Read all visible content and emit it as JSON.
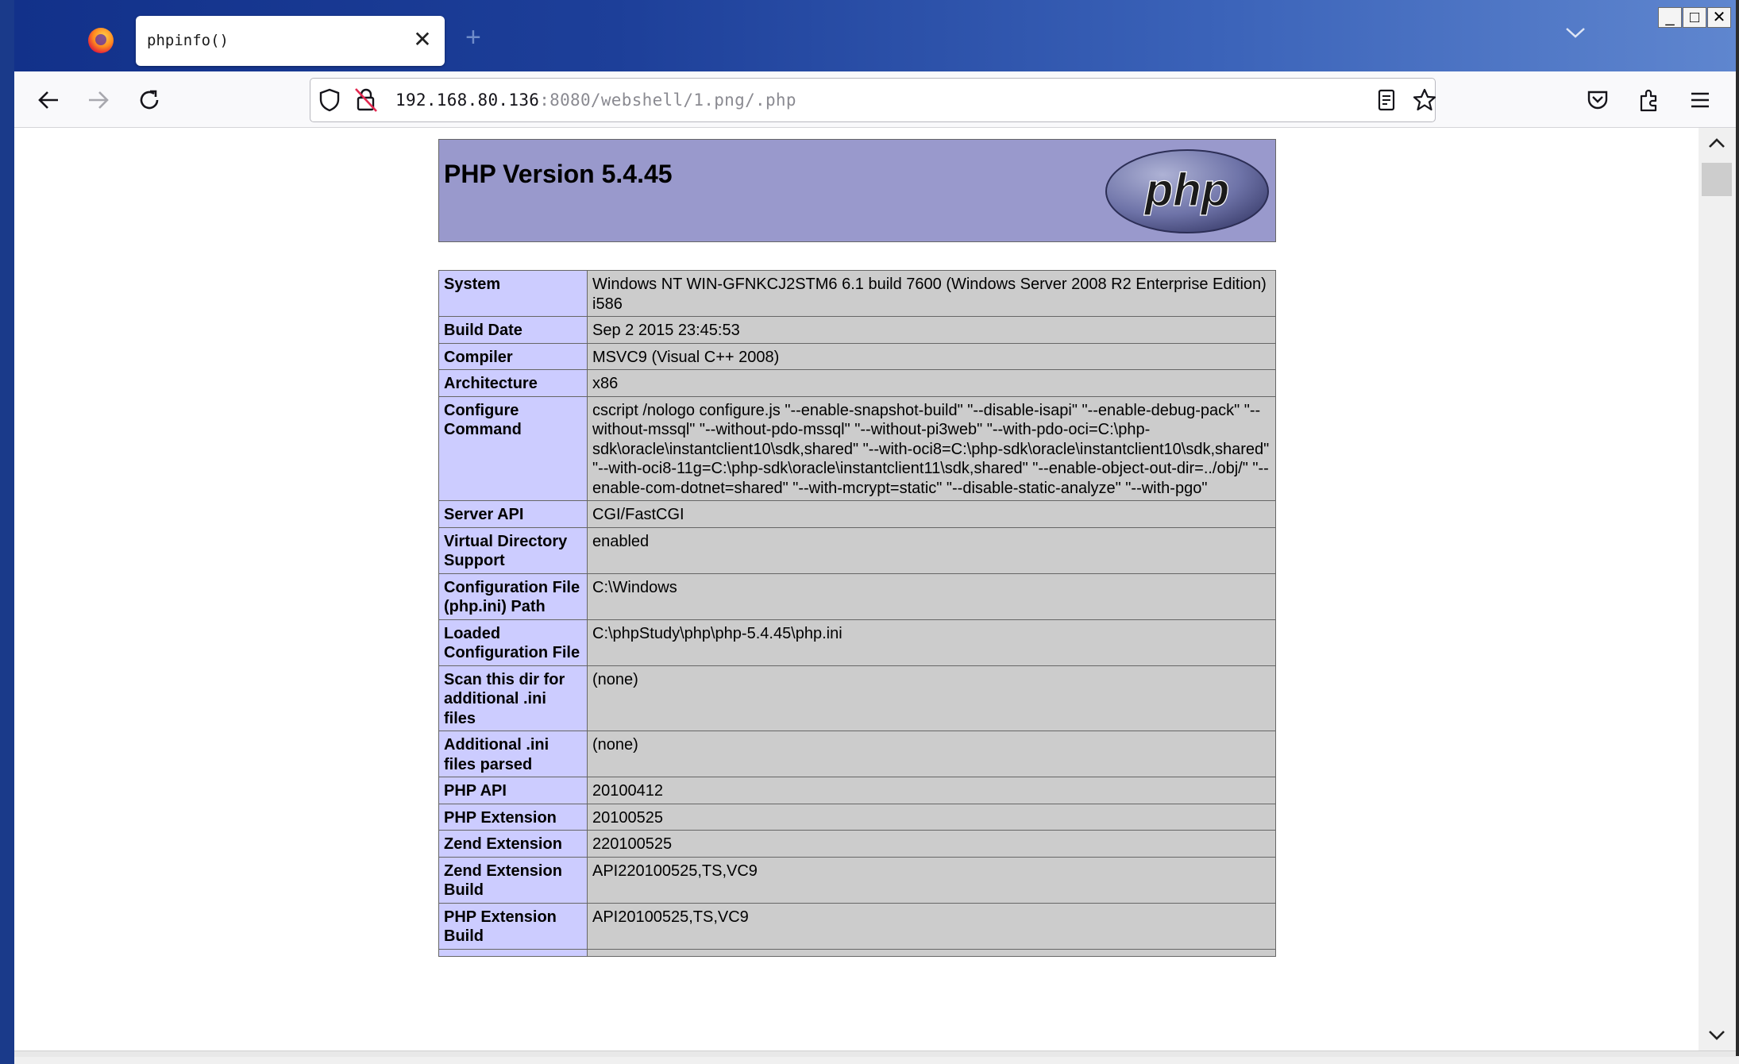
{
  "browser": {
    "tab_title": "phpinfo()",
    "url_host": "192.168.80.136",
    "url_rest": ":8080/webshell/1.png/.php",
    "icons": [
      "firefox-logo",
      "close-icon",
      "plus-icon",
      "chevron-down-icon",
      "back-arrow-icon",
      "forward-arrow-icon",
      "reload-icon",
      "shield-icon",
      "insecure-lock-icon",
      "reader-view-icon",
      "star-icon",
      "pocket-icon",
      "extensions-icon",
      "hamburger-menu-icon"
    ],
    "window_controls": {
      "minimize": "_",
      "maximize": "□",
      "close": "✕"
    }
  },
  "page": {
    "title": "PHP Version 5.4.45",
    "logo_text": "php",
    "header_bg": "#9999cc",
    "label_bg": "#ccccff",
    "value_bg": "#cccccc",
    "rows": [
      {
        "label": "System",
        "value": "Windows NT WIN-GFNKCJ2STM6 6.1 build 7600 (Windows Server 2008 R2 Enterprise Edition) i586"
      },
      {
        "label": "Build Date",
        "value": "Sep 2 2015 23:45:53"
      },
      {
        "label": "Compiler",
        "value": "MSVC9 (Visual C++ 2008)"
      },
      {
        "label": "Architecture",
        "value": "x86"
      },
      {
        "label": "Configure Command",
        "value": "cscript /nologo configure.js \"--enable-snapshot-build\" \"--disable-isapi\" \"--enable-debug-pack\" \"--without-mssql\" \"--without-pdo-mssql\" \"--without-pi3web\" \"--with-pdo-oci=C:\\php-sdk\\oracle\\instantclient10\\sdk,shared\" \"--with-oci8=C:\\php-sdk\\oracle\\instantclient10\\sdk,shared\" \"--with-oci8-11g=C:\\php-sdk\\oracle\\instantclient11\\sdk,shared\" \"--enable-object-out-dir=../obj/\" \"--enable-com-dotnet=shared\" \"--with-mcrypt=static\" \"--disable-static-analyze\" \"--with-pgo\""
      },
      {
        "label": "Server API",
        "value": "CGI/FastCGI"
      },
      {
        "label": "Virtual Directory Support",
        "value": "enabled"
      },
      {
        "label": "Configuration File (php.ini) Path",
        "value": "C:\\Windows"
      },
      {
        "label": "Loaded Configuration File",
        "value": "C:\\phpStudy\\php\\php-5.4.45\\php.ini"
      },
      {
        "label": "Scan this dir for additional .ini files",
        "value": "(none)"
      },
      {
        "label": "Additional .ini files parsed",
        "value": "(none)"
      },
      {
        "label": "PHP API",
        "value": "20100412"
      },
      {
        "label": "PHP Extension",
        "value": "20100525"
      },
      {
        "label": "Zend Extension",
        "value": "220100525"
      },
      {
        "label": "Zend Extension Build",
        "value": "API220100525,TS,VC9"
      },
      {
        "label": "PHP Extension Build",
        "value": "API20100525,TS,VC9"
      },
      {
        "label": "",
        "value": ""
      }
    ]
  }
}
